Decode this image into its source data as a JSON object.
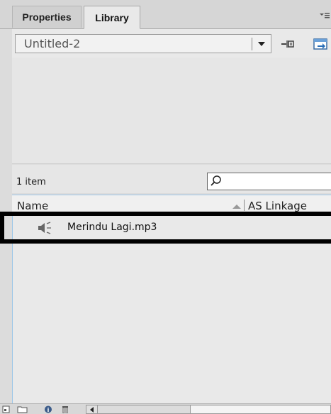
{
  "tabs": {
    "properties_label": "Properties",
    "library_label": "Library"
  },
  "document_selector": {
    "value": "Untitled-2"
  },
  "library": {
    "item_count": "1 item",
    "search_placeholder": "",
    "columns": {
      "name": "Name",
      "linkage": "AS Linkage"
    },
    "items": [
      {
        "icon": "sound-icon",
        "name": "Merindu Lagi.mp3"
      }
    ]
  },
  "icons": {
    "panel_menu": "panel-menu-icon",
    "pin": "pin-library-icon",
    "new_library_panel": "new-library-panel-icon",
    "search": "search-icon",
    "new_symbol": "new-symbol-icon",
    "new_folder": "new-folder-icon",
    "properties": "properties-icon",
    "delete": "trash-icon"
  },
  "colors": {
    "panel_bg": "#e9e9e9",
    "selection_outline": "#000000",
    "accent_border": "#9cc6e8"
  }
}
